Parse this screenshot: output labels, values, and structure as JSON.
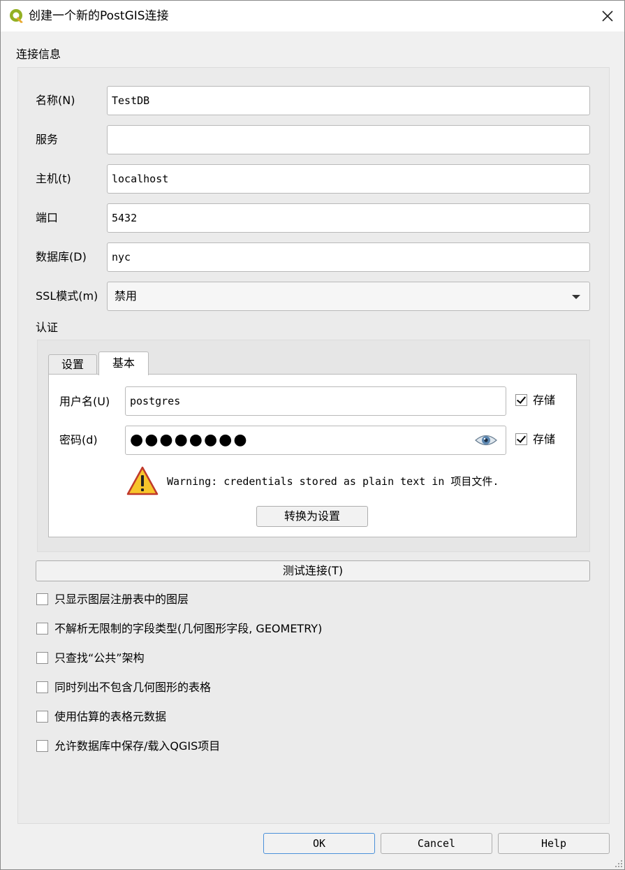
{
  "window": {
    "title": "创建一个新的PostGIS连接",
    "accent_color": "#4a90d9"
  },
  "connection_info": {
    "group_title": "连接信息",
    "fields": {
      "name": {
        "label": "名称(N)",
        "value": "TestDB"
      },
      "service": {
        "label": "服务",
        "value": ""
      },
      "host": {
        "label": "主机(t)",
        "value": "localhost"
      },
      "port": {
        "label": "端口",
        "value": "5432"
      },
      "database": {
        "label": "数据库(D)",
        "value": "nyc"
      },
      "ssl_mode": {
        "label": "SSL模式(m)",
        "value": "禁用"
      }
    }
  },
  "auth": {
    "group_title": "认证",
    "tabs": [
      {
        "label": "设置",
        "active": false
      },
      {
        "label": "基本",
        "active": true
      }
    ],
    "username": {
      "label": "用户名(U)",
      "value": "postgres",
      "store_label": "存储",
      "store_checked": true
    },
    "password": {
      "label": "密码(d)",
      "masked": "●●●●●●●●",
      "store_label": "存储",
      "store_checked": true
    },
    "warning_text": "Warning: credentials stored as plain text in 项目文件.",
    "convert_button": "转换为设置"
  },
  "test_connection_button": "测试连接(T)",
  "options": [
    {
      "label": "只显示图层注册表中的图层",
      "checked": false
    },
    {
      "label": "不解析无限制的字段类型(几何图形字段, GEOMETRY)",
      "checked": false
    },
    {
      "label": "只查找“公共”架构",
      "checked": false
    },
    {
      "label": "同时列出不包含几何图形的表格",
      "checked": false
    },
    {
      "label": "使用估算的表格元数据",
      "checked": false
    },
    {
      "label": "允许数据库中保存/载入QGIS项目",
      "checked": false
    }
  ],
  "footer": {
    "ok": "OK",
    "cancel": "Cancel",
    "help": "Help"
  }
}
